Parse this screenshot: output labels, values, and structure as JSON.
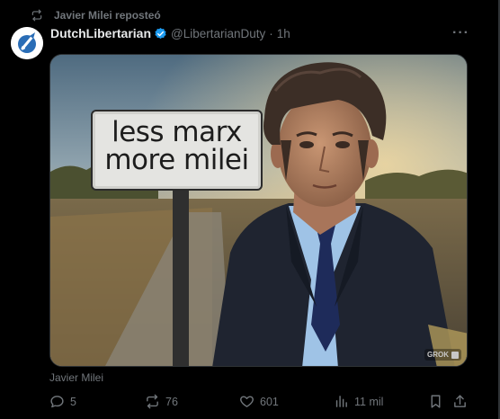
{
  "repost": {
    "icon": "repost-icon",
    "text": "Javier Milei reposteó"
  },
  "author": {
    "display_name": "DutchLibertarian",
    "handle": "@LibertarianDuty",
    "separator": "·",
    "time": "1h",
    "verified": true,
    "verified_color": "#1d9bf0"
  },
  "more_label": "···",
  "media": {
    "sign_line_1": "less marx",
    "sign_line_2": "more milei",
    "badge": "GROK"
  },
  "caption": "Javier Milei",
  "actions": {
    "replies": "5",
    "reposts": "76",
    "likes": "601",
    "views": "11 mil"
  },
  "colors": {
    "background": "#000000",
    "primary_text": "#e7e9ea",
    "secondary_text": "#71767b",
    "border": "#2f3336"
  }
}
